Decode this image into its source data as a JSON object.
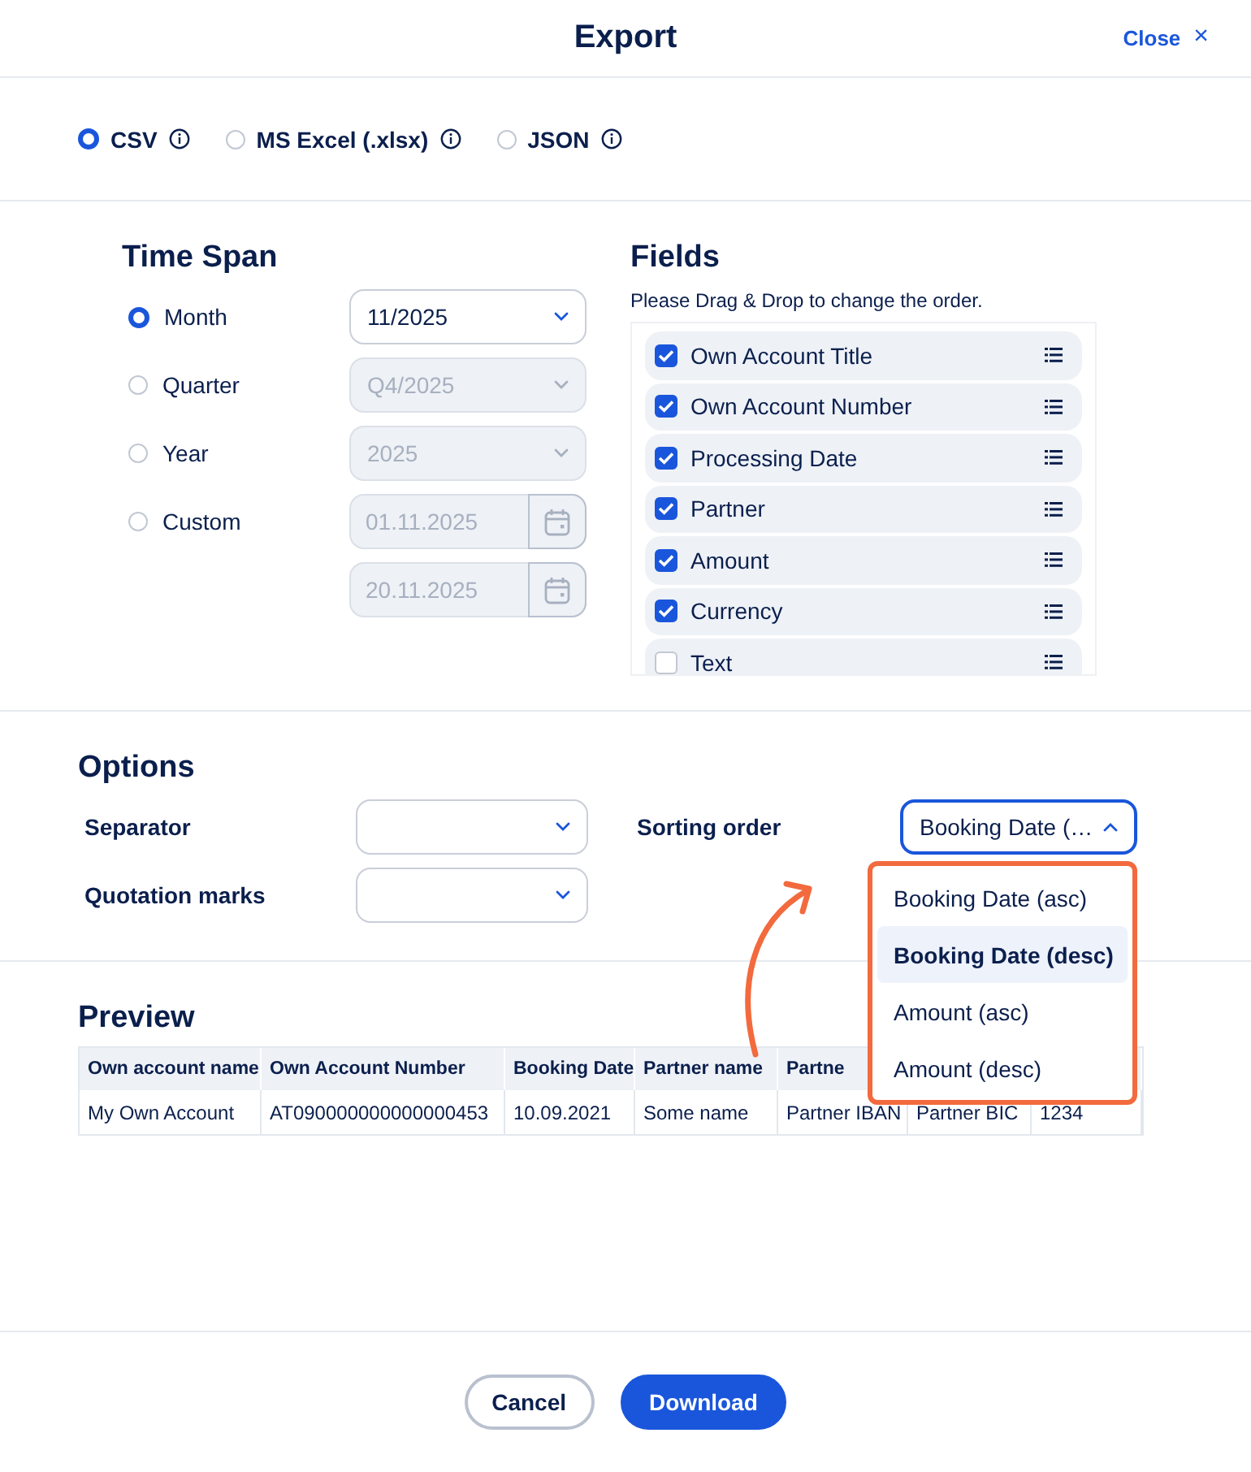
{
  "dialog": {
    "title": "Export",
    "close": {
      "label": "Close",
      "icon": "×"
    }
  },
  "formats": [
    {
      "label": "CSV",
      "selected": true
    },
    {
      "label": "MS Excel (.xlsx)",
      "selected": false
    },
    {
      "label": "JSON",
      "selected": false
    }
  ],
  "time_span": {
    "title": "Time Span",
    "options": [
      {
        "label": "Month",
        "selected": true,
        "kind": "select",
        "disabled": false,
        "values": [
          "11/2025"
        ]
      },
      {
        "label": "Quarter",
        "selected": false,
        "kind": "select",
        "disabled": true,
        "values": [
          "Q4/2025"
        ]
      },
      {
        "label": "Year",
        "selected": false,
        "kind": "select",
        "disabled": true,
        "values": [
          "2025"
        ]
      },
      {
        "label": "Custom",
        "selected": false,
        "kind": "dates",
        "disabled": true,
        "values": [
          "01.11.2025",
          "20.11.2025"
        ]
      }
    ]
  },
  "fields": {
    "title": "Fields",
    "hint": "Please Drag & Drop to change the order.",
    "items": [
      {
        "label": "Own Account Title",
        "checked": true
      },
      {
        "label": "Own Account Number",
        "checked": true
      },
      {
        "label": "Processing Date",
        "checked": true
      },
      {
        "label": "Partner",
        "checked": true
      },
      {
        "label": "Amount",
        "checked": true
      },
      {
        "label": "Currency",
        "checked": true
      },
      {
        "label": "Text",
        "checked": false
      }
    ]
  },
  "options": {
    "title": "Options",
    "separator": {
      "label": "Separator"
    },
    "quotation_marks": {
      "label": "Quotation marks"
    },
    "sorting_order": {
      "label": "Sorting order",
      "value": "Booking Date (…",
      "expanded": true,
      "options": [
        {
          "label": "Booking Date (asc)",
          "selected": false
        },
        {
          "label": "Booking Date (desc)",
          "selected": true
        },
        {
          "label": "Amount (asc)",
          "selected": false
        },
        {
          "label": "Amount (desc)",
          "selected": false
        }
      ]
    }
  },
  "preview": {
    "title": "Preview",
    "columns": [
      "Own account name",
      "Own Account Number",
      "Booking Date",
      "Partner name",
      "Partne"
    ],
    "rows": [
      [
        "My Own Account",
        "AT090000000000000453",
        "10.09.2021",
        "Some name",
        "Partner IBAN",
        "Partner BIC",
        "1234"
      ]
    ]
  },
  "buttons": [
    {
      "label": "Cancel",
      "kind": "secondary"
    },
    {
      "label": "Download",
      "kind": "primary"
    }
  ]
}
